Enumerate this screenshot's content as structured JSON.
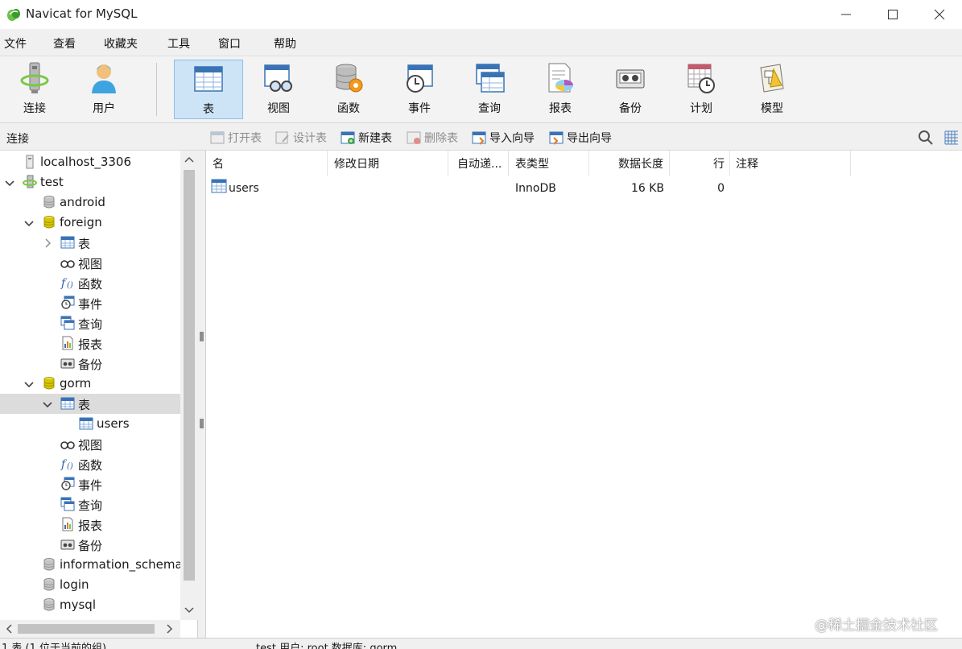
{
  "window": {
    "title": "Navicat for MySQL"
  },
  "menu": [
    "文件",
    "查看",
    "收藏夹",
    "工具",
    "窗口",
    "帮助"
  ],
  "toolbar": {
    "items": [
      {
        "label": "连接",
        "icon": "connection-icon"
      },
      {
        "label": "用户",
        "icon": "user-icon"
      },
      {
        "label": "表",
        "icon": "table-icon",
        "active": true
      },
      {
        "label": "视图",
        "icon": "view-icon"
      },
      {
        "label": "函数",
        "icon": "function-icon"
      },
      {
        "label": "事件",
        "icon": "event-icon"
      },
      {
        "label": "查询",
        "icon": "query-icon"
      },
      {
        "label": "报表",
        "icon": "report-icon"
      },
      {
        "label": "备份",
        "icon": "backup-icon"
      },
      {
        "label": "计划",
        "icon": "schedule-icon"
      },
      {
        "label": "模型",
        "icon": "model-icon"
      }
    ]
  },
  "subbar": {
    "connection_label": "连接",
    "actions": [
      {
        "label": "打开表",
        "enabled": false
      },
      {
        "label": "设计表",
        "enabled": false
      },
      {
        "label": "新建表",
        "enabled": true
      },
      {
        "label": "删除表",
        "enabled": false
      },
      {
        "label": "导入向导",
        "enabled": true
      },
      {
        "label": "导出向导",
        "enabled": true
      }
    ]
  },
  "tree": [
    {
      "label": "localhost_3306",
      "type": "server",
      "level": 0
    },
    {
      "label": "test",
      "type": "connection",
      "level": 0,
      "expanded": true
    },
    {
      "label": "android",
      "type": "database",
      "level": 1
    },
    {
      "label": "foreign",
      "type": "database-open",
      "level": 1,
      "expanded": true
    },
    {
      "label": "表",
      "type": "tables",
      "level": 2,
      "collapsed": true
    },
    {
      "label": "视图",
      "type": "views",
      "level": 2
    },
    {
      "label": "函数",
      "type": "functions",
      "level": 2
    },
    {
      "label": "事件",
      "type": "events",
      "level": 2
    },
    {
      "label": "查询",
      "type": "queries",
      "level": 2
    },
    {
      "label": "报表",
      "type": "reports",
      "level": 2
    },
    {
      "label": "备份",
      "type": "backups",
      "level": 2
    },
    {
      "label": "gorm",
      "type": "database-open",
      "level": 1,
      "expanded": true
    },
    {
      "label": "表",
      "type": "tables",
      "level": 2,
      "expanded": true,
      "selected": true
    },
    {
      "label": "users",
      "type": "table",
      "level": 3
    },
    {
      "label": "视图",
      "type": "views",
      "level": 2
    },
    {
      "label": "函数",
      "type": "functions",
      "level": 2
    },
    {
      "label": "事件",
      "type": "events",
      "level": 2
    },
    {
      "label": "查询",
      "type": "queries",
      "level": 2
    },
    {
      "label": "报表",
      "type": "reports",
      "level": 2
    },
    {
      "label": "备份",
      "type": "backups",
      "level": 2
    },
    {
      "label": "information_schema",
      "type": "database",
      "level": 1
    },
    {
      "label": "login",
      "type": "database",
      "level": 1
    },
    {
      "label": "mysql",
      "type": "database",
      "level": 1
    }
  ],
  "grid": {
    "columns": [
      "名",
      "修改日期",
      "自动递...",
      "表类型",
      "数据长度",
      "行",
      "注释"
    ],
    "rows": [
      {
        "name": "users",
        "modified": "",
        "auto_inc": "",
        "engine": "InnoDB",
        "data_length": "16 KB",
        "rows": "0",
        "comment": ""
      }
    ]
  },
  "status": {
    "left": "1 表 (1 位于当前的组)",
    "right": "test   用户: root   数据库: gorm"
  },
  "watermark": "@稀土掘金技术社区",
  "colors": {
    "active_tool_bg": "#cde4f7",
    "selected_row_bg": "#dcdcdc",
    "db_yellow": "#d6c400"
  }
}
